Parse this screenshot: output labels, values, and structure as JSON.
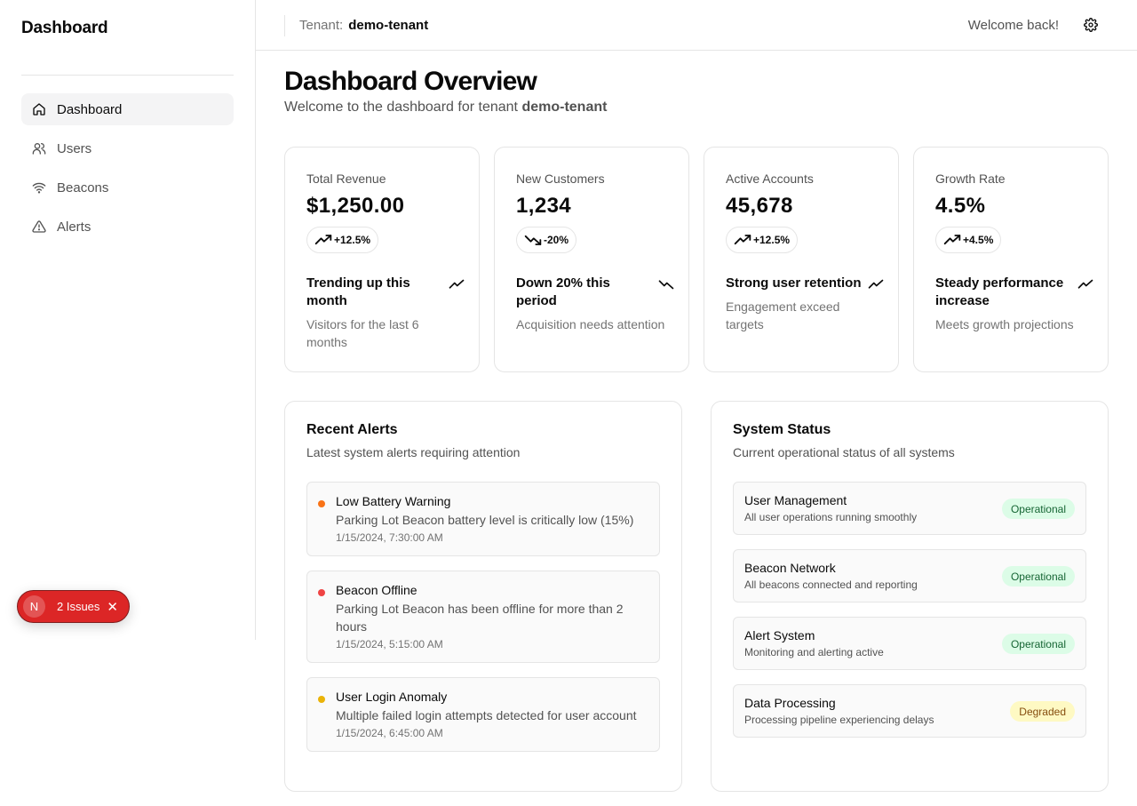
{
  "sidebar": {
    "brand": "Dashboard",
    "items": [
      {
        "label": "Dashboard",
        "icon": "home-icon",
        "active": true
      },
      {
        "label": "Users",
        "icon": "users-icon"
      },
      {
        "label": "Beacons",
        "icon": "wifi-icon"
      },
      {
        "label": "Alerts",
        "icon": "alert-triangle-icon"
      }
    ]
  },
  "header": {
    "tenant_label": "Tenant:",
    "tenant_name": "demo-tenant",
    "welcome": "Welcome back!",
    "settings_icon": "gear-icon"
  },
  "main": {
    "title": "Dashboard Overview",
    "subtitle_prefix": "Welcome to the dashboard for tenant",
    "subtitle_tenant": "demo-tenant"
  },
  "stats": [
    {
      "label": "Total Revenue",
      "value": "$1,250.00",
      "change": "+12.5%",
      "direction": "up",
      "trend": "Trending up this month",
      "desc": "Visitors for the last 6 months"
    },
    {
      "label": "New Customers",
      "value": "1,234",
      "change": "-20%",
      "direction": "down",
      "trend": "Down 20% this period",
      "desc": "Acquisition needs attention"
    },
    {
      "label": "Active Accounts",
      "value": "45,678",
      "change": "+12.5%",
      "direction": "up",
      "trend": "Strong user retention",
      "desc": "Engagement exceed targets"
    },
    {
      "label": "Growth Rate",
      "value": "4.5%",
      "change": "+4.5%",
      "direction": "up",
      "trend": "Steady performance increase",
      "desc": "Meets growth projections"
    }
  ],
  "alerts_panel": {
    "title": "Recent Alerts",
    "subtitle": "Latest system alerts requiring attention",
    "items": [
      {
        "title": "Low Battery Warning",
        "message": "Parking Lot Beacon battery level is critically low (15%)",
        "time": "1/15/2024, 7:30:00 AM",
        "color": "#f97316"
      },
      {
        "title": "Beacon Offline",
        "message": "Parking Lot Beacon has been offline for more than 2 hours",
        "time": "1/15/2024, 5:15:00 AM",
        "color": "#ef4444"
      },
      {
        "title": "User Login Anomaly",
        "message": "Multiple failed login attempts detected for user account",
        "time": "1/15/2024, 6:45:00 AM",
        "color": "#eab308"
      }
    ]
  },
  "status_panel": {
    "title": "System Status",
    "subtitle": "Current operational status of all systems",
    "items": [
      {
        "name": "User Management",
        "desc": "All user operations running smoothly",
        "status": "Operational"
      },
      {
        "name": "Beacon Network",
        "desc": "All beacons connected and reporting",
        "status": "Operational"
      },
      {
        "name": "Alert System",
        "desc": "Monitoring and alerting active",
        "status": "Operational"
      },
      {
        "name": "Data Processing",
        "desc": "Processing pipeline experiencing delays",
        "status": "Degraded"
      }
    ]
  },
  "issues_toast": {
    "avatar": "N",
    "label": "2 Issues",
    "close": "✕"
  }
}
